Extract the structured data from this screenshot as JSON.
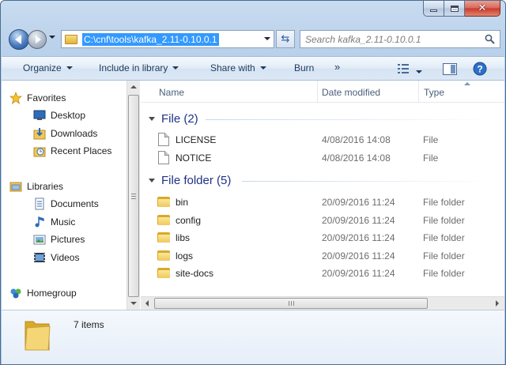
{
  "address": {
    "path": "C:\\cnf\\tools\\kafka_2.11-0.10.0.1"
  },
  "search": {
    "placeholder": "Search kafka_2.11-0.10.0.1"
  },
  "toolbar": {
    "organize": "Organize",
    "include_in_library": "Include in library",
    "share_with": "Share with",
    "burn": "Burn",
    "more": "»"
  },
  "nav": {
    "favorites": "Favorites",
    "desktop": "Desktop",
    "downloads": "Downloads",
    "recent_places": "Recent Places",
    "libraries": "Libraries",
    "documents": "Documents",
    "music": "Music",
    "pictures": "Pictures",
    "videos": "Videos",
    "homegroup": "Homegroup"
  },
  "columns": {
    "name": "Name",
    "date_modified": "Date modified",
    "type": "Type"
  },
  "groups": {
    "files": {
      "label": "File (2)",
      "items": [
        {
          "name": "LICENSE",
          "date": "4/08/2016 14:08",
          "type": "File"
        },
        {
          "name": "NOTICE",
          "date": "4/08/2016 14:08",
          "type": "File"
        }
      ]
    },
    "folders": {
      "label": "File folder (5)",
      "items": [
        {
          "name": "bin",
          "date": "20/09/2016 11:24",
          "type": "File folder"
        },
        {
          "name": "config",
          "date": "20/09/2016 11:24",
          "type": "File folder"
        },
        {
          "name": "libs",
          "date": "20/09/2016 11:24",
          "type": "File folder"
        },
        {
          "name": "logs",
          "date": "20/09/2016 11:24",
          "type": "File folder"
        },
        {
          "name": "site-docs",
          "date": "20/09/2016 11:24",
          "type": "File folder"
        }
      ]
    }
  },
  "details": {
    "count": "7 items"
  },
  "colors": {
    "selection": "#3399ff",
    "group_header": "#1e3287",
    "window_frame": "#b9d1ea"
  }
}
